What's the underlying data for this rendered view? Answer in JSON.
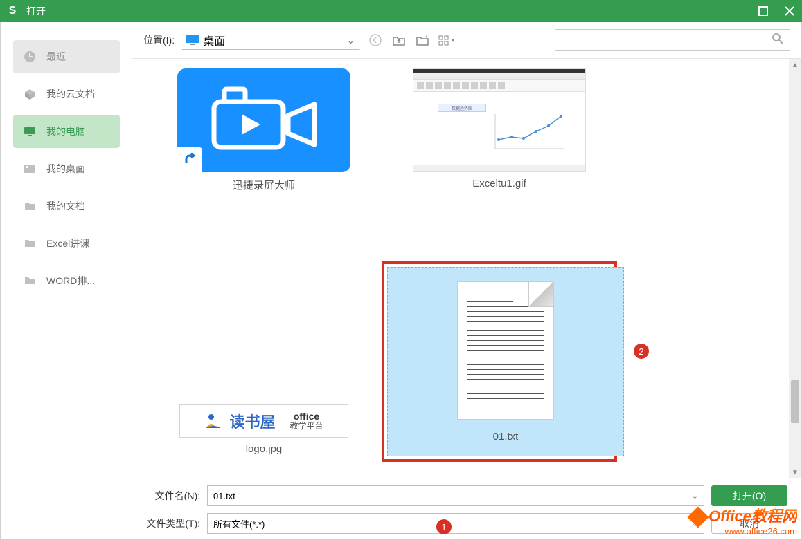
{
  "window": {
    "title": "打开"
  },
  "sidebar": {
    "items": [
      {
        "label": "最近",
        "icon": "clock"
      },
      {
        "label": "我的云文档",
        "icon": "cube"
      },
      {
        "label": "我的电脑",
        "icon": "monitor"
      },
      {
        "label": "我的桌面",
        "icon": "desktop"
      },
      {
        "label": "我的文档",
        "icon": "folder"
      },
      {
        "label": "Excel讲课",
        "icon": "folder"
      },
      {
        "label": "WORD排...",
        "icon": "folder"
      }
    ]
  },
  "toolbar": {
    "location_label": "位置(I):",
    "location_value": "桌面",
    "search_placeholder": ""
  },
  "files": {
    "row1": [
      {
        "name": "迅捷录屏大师",
        "type": "video-shortcut"
      },
      {
        "name": "Exceltu1.gif",
        "type": "gif"
      }
    ],
    "row2": [
      {
        "name": "logo.jpg",
        "type": "image",
        "logo_text1": "读书屋",
        "logo_text2": "office",
        "logo_text3": "教学平台"
      },
      {
        "name": "01.txt",
        "type": "text",
        "selected": true
      }
    ]
  },
  "bottom": {
    "filename_label": "文件名(N):",
    "filename_value": "01.txt",
    "filetype_label": "文件类型(T):",
    "filetype_value": "所有文件(*.*)",
    "open_button": "打开(O)",
    "cancel_button": "取消"
  },
  "badges": {
    "b1": "1",
    "b2": "2"
  },
  "watermark": {
    "line1": "Office教程网",
    "line2": "www.office26.com"
  }
}
